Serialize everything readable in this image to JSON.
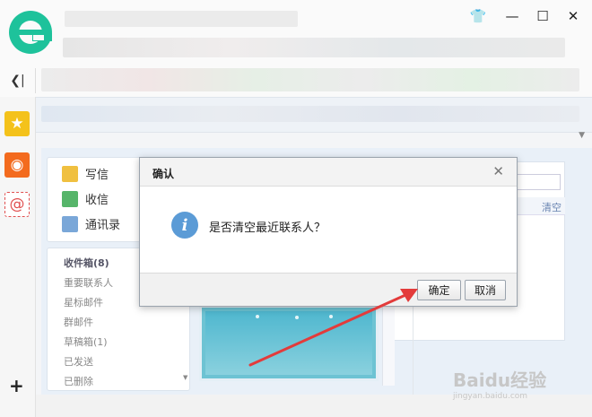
{
  "browser": {
    "logo_icon": "browser-e-logo",
    "window_controls": [
      "skin-icon",
      "minimize-icon",
      "maximize-icon",
      "close-icon"
    ],
    "sidebar_toggle_icon": "collapse-sidebar-icon",
    "sidebar_icons": [
      "favorites-star-icon",
      "weibo-icon",
      "mail-at-icon"
    ],
    "add_icon": "add-icon"
  },
  "mail": {
    "actions": [
      {
        "label": "写信",
        "icon": "compose-icon"
      },
      {
        "label": "收信",
        "icon": "inbox-download-icon"
      },
      {
        "label": "通讯录",
        "icon": "contacts-icon"
      }
    ],
    "folders": [
      "收件箱(8)",
      "重要联系人",
      "星标邮件",
      "群邮件",
      "草稿箱(1)",
      "已发送",
      "已删除"
    ],
    "clear_label": "清空"
  },
  "dialog": {
    "title": "确认",
    "message": "是否清空最近联系人？",
    "ok_label": "确定",
    "cancel_label": "取消"
  },
  "watermark": {
    "brand": "Baidu经验",
    "url": "jingyan.baidu.com"
  },
  "colors": {
    "logo": "#1ec29b",
    "info_icon": "#5b9bd6",
    "annotation_arrow": "#e33b3b"
  }
}
